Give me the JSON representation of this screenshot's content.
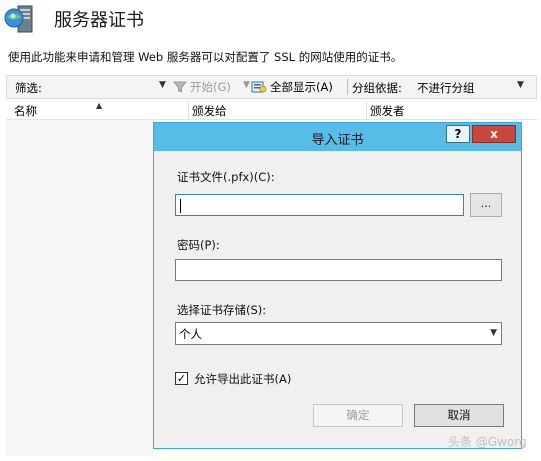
{
  "header": {
    "title": "服务器证书",
    "description": "使用此功能来申请和管理 Web 服务器可以对配置了 SSL 的网站使用的证书。"
  },
  "toolbar": {
    "filter_label": "筛选:",
    "start_label": "开始(G)",
    "show_all_label": "全部显示(A)",
    "group_by_label": "分组依据:",
    "group_by_value": "不进行分组"
  },
  "list": {
    "columns": [
      "名称",
      "颁发给",
      "颁发者"
    ]
  },
  "dialog": {
    "title": "导入证书",
    "help_label": "?",
    "close_label": "x",
    "cert_file_label": "证书文件(.pfx)(C):",
    "cert_file_value": "",
    "browse_label": "...",
    "password_label": "密码(P):",
    "password_value": "",
    "store_label": "选择证书存储(S):",
    "store_value": "个人",
    "allow_export_label": "允许导出此证书(A)",
    "allow_export_checked": true,
    "ok_label": "确定",
    "cancel_label": "取消"
  },
  "watermark": "头条 @Gworg",
  "colors": {
    "titlebar": "#56bce8",
    "close_button": "#c9463d",
    "dialog_border": "#3aa5de"
  },
  "icons": [
    "server-cert-icon",
    "filter-funnel-icon",
    "show-all-icon",
    "checkmark-icon",
    "dropdown-arrow-icon",
    "sort-arrow-icon"
  ]
}
